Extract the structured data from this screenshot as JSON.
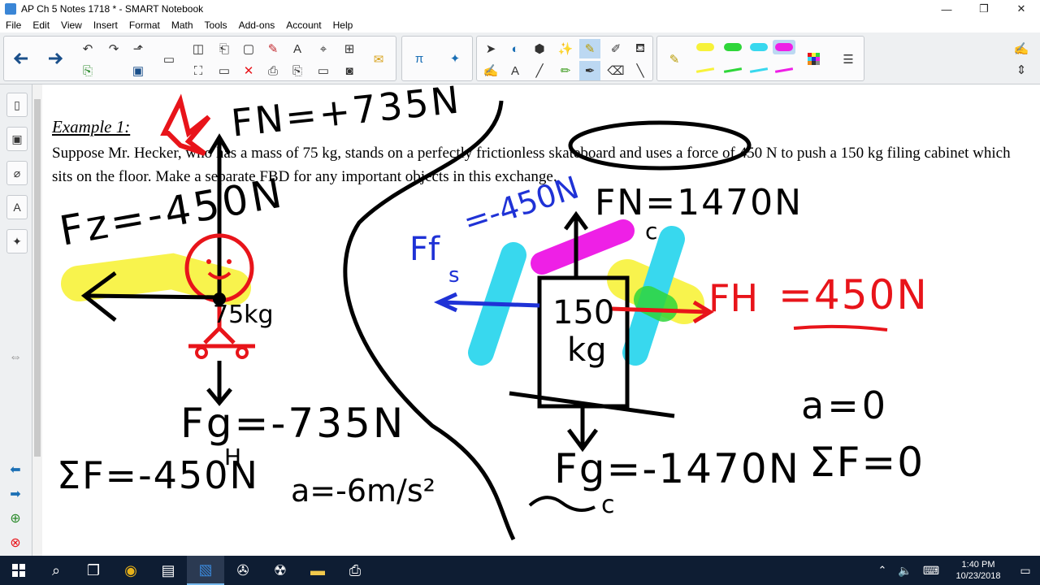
{
  "window": {
    "title": "AP Ch 5 Notes 1718 * - SMART Notebook",
    "minimize_glyph": "—",
    "restore_glyph": "❐",
    "close_glyph": "✕"
  },
  "menu": {
    "items": [
      {
        "label": "File"
      },
      {
        "label": "Edit"
      },
      {
        "label": "View"
      },
      {
        "label": "Insert"
      },
      {
        "label": "Format"
      },
      {
        "label": "Math"
      },
      {
        "label": "Tools"
      },
      {
        "label": "Add-ons"
      },
      {
        "label": "Account"
      },
      {
        "label": "Help"
      }
    ]
  },
  "page": {
    "example_title": "Example 1:",
    "problem_text": "Suppose Mr. Hecker, who has a mass of 75 kg, stands on a perfectly frictionless skateboard and uses a force of 450 N to push a 150 kg filing cabinet which sits on the floor.  Make a separate FBD for any important objects in this exchange."
  },
  "handwriting": {
    "fn_person": "FN=+735N",
    "fz": "Fz=-450N",
    "mass_person": "75kg",
    "fg_person": "Fg=-735N",
    "fg_sub": "H",
    "sum_f_person": "ΣF=-450N",
    "accel_person": "a=-6m/s²",
    "ff_label": "Ff",
    "ff_sub": "s",
    "ff_value": "=-450N",
    "fn_cabinet": "FN=1470N",
    "fn_sub": "c",
    "cabinet_mass": "150",
    "cabinet_unit": "kg",
    "fh_label": "FH",
    "fh_value": "=450N",
    "fg_cabinet": "Fg=-1470N",
    "fg_cabinet_sub": "c",
    "accel_cabinet": "a=0",
    "sum_f_cabinet": "ΣF=0"
  },
  "colors": {
    "ink_black": "#000000",
    "ink_red": "#e8141a",
    "ink_blue": "#1f32d6",
    "highlight_yellow": "#f7f23a",
    "highlight_cyan": "#38d8ee",
    "highlight_magenta": "#ee20e6",
    "highlight_green": "#2fd63a",
    "taskbar": "#0e1d33"
  },
  "taskbar": {
    "time": "1:40 PM",
    "date": "10/23/2018"
  }
}
